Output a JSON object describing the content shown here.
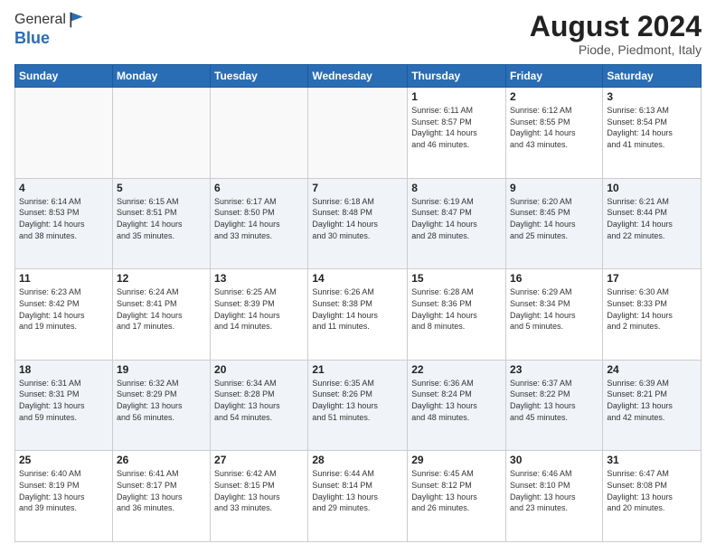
{
  "logo": {
    "line1": "General",
    "line2": "Blue"
  },
  "header": {
    "month_year": "August 2024",
    "location": "Piode, Piedmont, Italy"
  },
  "days_of_week": [
    "Sunday",
    "Monday",
    "Tuesday",
    "Wednesday",
    "Thursday",
    "Friday",
    "Saturday"
  ],
  "weeks": [
    [
      {
        "day": "",
        "info": ""
      },
      {
        "day": "",
        "info": ""
      },
      {
        "day": "",
        "info": ""
      },
      {
        "day": "",
        "info": ""
      },
      {
        "day": "1",
        "info": "Sunrise: 6:11 AM\nSunset: 8:57 PM\nDaylight: 14 hours\nand 46 minutes."
      },
      {
        "day": "2",
        "info": "Sunrise: 6:12 AM\nSunset: 8:55 PM\nDaylight: 14 hours\nand 43 minutes."
      },
      {
        "day": "3",
        "info": "Sunrise: 6:13 AM\nSunset: 8:54 PM\nDaylight: 14 hours\nand 41 minutes."
      }
    ],
    [
      {
        "day": "4",
        "info": "Sunrise: 6:14 AM\nSunset: 8:53 PM\nDaylight: 14 hours\nand 38 minutes."
      },
      {
        "day": "5",
        "info": "Sunrise: 6:15 AM\nSunset: 8:51 PM\nDaylight: 14 hours\nand 35 minutes."
      },
      {
        "day": "6",
        "info": "Sunrise: 6:17 AM\nSunset: 8:50 PM\nDaylight: 14 hours\nand 33 minutes."
      },
      {
        "day": "7",
        "info": "Sunrise: 6:18 AM\nSunset: 8:48 PM\nDaylight: 14 hours\nand 30 minutes."
      },
      {
        "day": "8",
        "info": "Sunrise: 6:19 AM\nSunset: 8:47 PM\nDaylight: 14 hours\nand 28 minutes."
      },
      {
        "day": "9",
        "info": "Sunrise: 6:20 AM\nSunset: 8:45 PM\nDaylight: 14 hours\nand 25 minutes."
      },
      {
        "day": "10",
        "info": "Sunrise: 6:21 AM\nSunset: 8:44 PM\nDaylight: 14 hours\nand 22 minutes."
      }
    ],
    [
      {
        "day": "11",
        "info": "Sunrise: 6:23 AM\nSunset: 8:42 PM\nDaylight: 14 hours\nand 19 minutes."
      },
      {
        "day": "12",
        "info": "Sunrise: 6:24 AM\nSunset: 8:41 PM\nDaylight: 14 hours\nand 17 minutes."
      },
      {
        "day": "13",
        "info": "Sunrise: 6:25 AM\nSunset: 8:39 PM\nDaylight: 14 hours\nand 14 minutes."
      },
      {
        "day": "14",
        "info": "Sunrise: 6:26 AM\nSunset: 8:38 PM\nDaylight: 14 hours\nand 11 minutes."
      },
      {
        "day": "15",
        "info": "Sunrise: 6:28 AM\nSunset: 8:36 PM\nDaylight: 14 hours\nand 8 minutes."
      },
      {
        "day": "16",
        "info": "Sunrise: 6:29 AM\nSunset: 8:34 PM\nDaylight: 14 hours\nand 5 minutes."
      },
      {
        "day": "17",
        "info": "Sunrise: 6:30 AM\nSunset: 8:33 PM\nDaylight: 14 hours\nand 2 minutes."
      }
    ],
    [
      {
        "day": "18",
        "info": "Sunrise: 6:31 AM\nSunset: 8:31 PM\nDaylight: 13 hours\nand 59 minutes."
      },
      {
        "day": "19",
        "info": "Sunrise: 6:32 AM\nSunset: 8:29 PM\nDaylight: 13 hours\nand 56 minutes."
      },
      {
        "day": "20",
        "info": "Sunrise: 6:34 AM\nSunset: 8:28 PM\nDaylight: 13 hours\nand 54 minutes."
      },
      {
        "day": "21",
        "info": "Sunrise: 6:35 AM\nSunset: 8:26 PM\nDaylight: 13 hours\nand 51 minutes."
      },
      {
        "day": "22",
        "info": "Sunrise: 6:36 AM\nSunset: 8:24 PM\nDaylight: 13 hours\nand 48 minutes."
      },
      {
        "day": "23",
        "info": "Sunrise: 6:37 AM\nSunset: 8:22 PM\nDaylight: 13 hours\nand 45 minutes."
      },
      {
        "day": "24",
        "info": "Sunrise: 6:39 AM\nSunset: 8:21 PM\nDaylight: 13 hours\nand 42 minutes."
      }
    ],
    [
      {
        "day": "25",
        "info": "Sunrise: 6:40 AM\nSunset: 8:19 PM\nDaylight: 13 hours\nand 39 minutes."
      },
      {
        "day": "26",
        "info": "Sunrise: 6:41 AM\nSunset: 8:17 PM\nDaylight: 13 hours\nand 36 minutes."
      },
      {
        "day": "27",
        "info": "Sunrise: 6:42 AM\nSunset: 8:15 PM\nDaylight: 13 hours\nand 33 minutes."
      },
      {
        "day": "28",
        "info": "Sunrise: 6:44 AM\nSunset: 8:14 PM\nDaylight: 13 hours\nand 29 minutes."
      },
      {
        "day": "29",
        "info": "Sunrise: 6:45 AM\nSunset: 8:12 PM\nDaylight: 13 hours\nand 26 minutes."
      },
      {
        "day": "30",
        "info": "Sunrise: 6:46 AM\nSunset: 8:10 PM\nDaylight: 13 hours\nand 23 minutes."
      },
      {
        "day": "31",
        "info": "Sunrise: 6:47 AM\nSunset: 8:08 PM\nDaylight: 13 hours\nand 20 minutes."
      }
    ]
  ]
}
